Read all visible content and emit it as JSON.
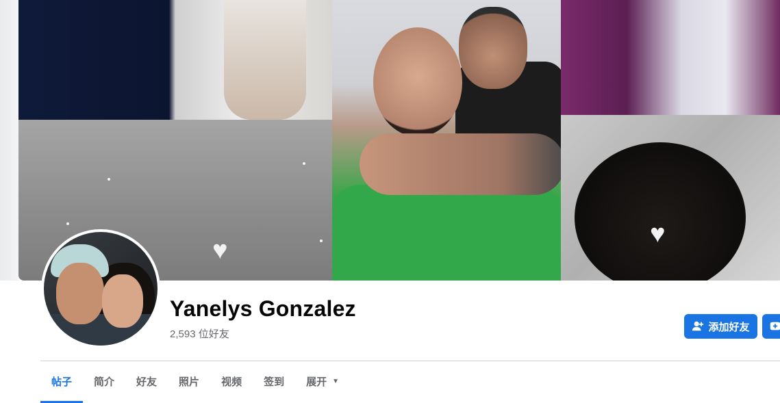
{
  "profile": {
    "name": "Yanelys Gonzalez",
    "friends_count": "2,593 位好友"
  },
  "actions": {
    "add_friend_label": "添加好友"
  },
  "tabs": [
    {
      "label": "帖子",
      "active": true
    },
    {
      "label": "简介"
    },
    {
      "label": "好友"
    },
    {
      "label": "照片"
    },
    {
      "label": "视频"
    },
    {
      "label": "签到"
    },
    {
      "label": "展开",
      "icon": "caret-down-icon"
    }
  ],
  "colors": {
    "accent": "#1b74e4",
    "name_text": "#050505",
    "secondary_text": "#65676b",
    "divider": "#ced0d4"
  }
}
